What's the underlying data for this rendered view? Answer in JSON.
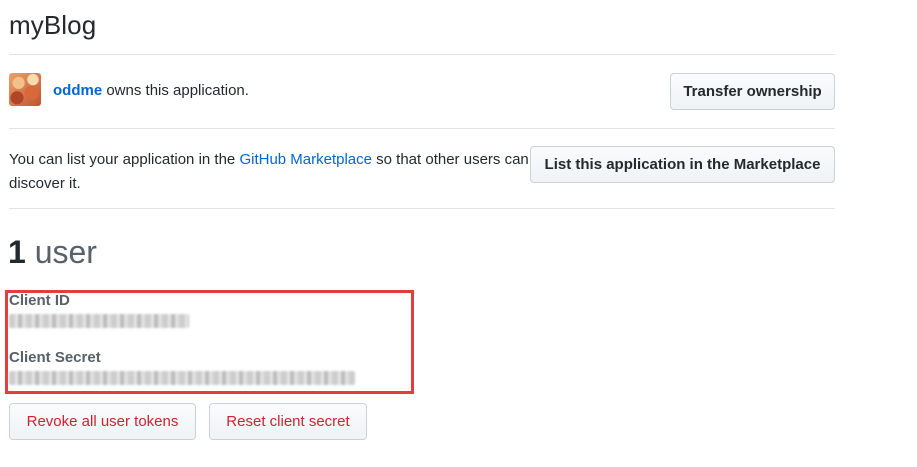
{
  "app": {
    "title": "myBlog"
  },
  "owner": {
    "username": "oddme",
    "suffix": " owns this application.",
    "transfer_label": "Transfer ownership"
  },
  "marketplace": {
    "text_before": "You can list your application in the ",
    "link_text": "GitHub Marketplace",
    "text_after": " so that other users can discover it.",
    "button_label": "List this application in the Marketplace"
  },
  "users": {
    "count": "1",
    "unit": " user"
  },
  "credentials": {
    "client_id_label": "Client ID",
    "client_secret_label": "Client Secret",
    "highlight_color": "#e33e3e"
  },
  "actions": {
    "revoke_label": "Revoke all user tokens",
    "reset_label": "Reset client secret"
  },
  "colors": {
    "link": "#0366d6",
    "danger": "#cb2431",
    "text": "#24292e",
    "muted": "#586069",
    "border": "#e1e4e8"
  }
}
